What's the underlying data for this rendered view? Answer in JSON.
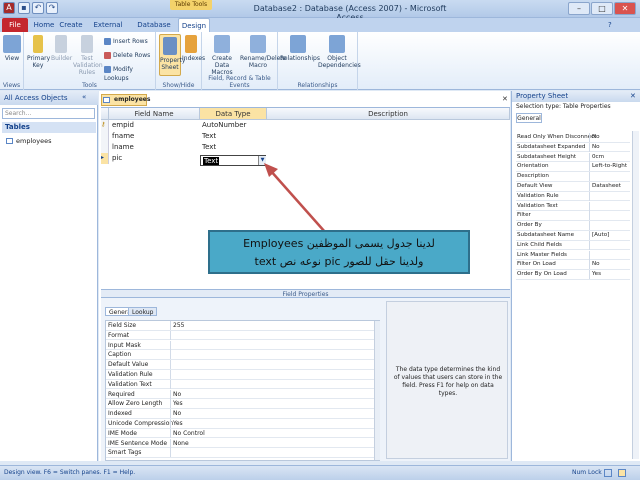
{
  "window": {
    "title": "Database2 : Database (Access 2007) - Microsoft Access",
    "context_tab": "Table Tools"
  },
  "tabs": [
    "File",
    "Home",
    "Create",
    "External Data",
    "Database Tools",
    "Design"
  ],
  "ribbon": {
    "views": {
      "view_label": "View",
      "group": "Views"
    },
    "tools": {
      "primary_key": "Primary Key",
      "builder": "Builder",
      "test_validation": "Test Validation Rules",
      "insert_rows": "Insert Rows",
      "delete_rows": "Delete Rows",
      "modify_lookups": "Modify Lookups",
      "group": "Tools"
    },
    "showhide": {
      "property_sheet": "Property Sheet",
      "indexes": "Indexes",
      "group": "Show/Hide"
    },
    "events": {
      "create_macros": "Create Data Macros",
      "rename_macro": "Rename/Delete Macro",
      "group": "Field, Record & Table Events"
    },
    "relationships": {
      "relationships": "Relationships",
      "dependencies": "Object Dependencies",
      "group": "Relationships"
    }
  },
  "nav": {
    "header": "All Access Objects",
    "search_placeholder": "Search...",
    "section": "Tables",
    "item": "employees"
  },
  "doc_tab": "employees",
  "grid": {
    "headers": [
      "Field Name",
      "Data Type",
      "Description"
    ],
    "rows": [
      {
        "name": "empid",
        "type": "AutoNumber"
      },
      {
        "name": "fname",
        "type": "Text"
      },
      {
        "name": "lname",
        "type": "Text"
      },
      {
        "name": "pic",
        "type": "Text"
      }
    ]
  },
  "field_properties": {
    "label": "Field Properties",
    "tabs": [
      "General",
      "Lookup"
    ],
    "rows": [
      {
        "k": "Field Size",
        "v": "255"
      },
      {
        "k": "Format",
        "v": ""
      },
      {
        "k": "Input Mask",
        "v": ""
      },
      {
        "k": "Caption",
        "v": ""
      },
      {
        "k": "Default Value",
        "v": ""
      },
      {
        "k": "Validation Rule",
        "v": ""
      },
      {
        "k": "Validation Text",
        "v": ""
      },
      {
        "k": "Required",
        "v": "No"
      },
      {
        "k": "Allow Zero Length",
        "v": "Yes"
      },
      {
        "k": "Indexed",
        "v": "No"
      },
      {
        "k": "Unicode Compression",
        "v": "Yes"
      },
      {
        "k": "IME Mode",
        "v": "No Control"
      },
      {
        "k": "IME Sentence Mode",
        "v": "None"
      },
      {
        "k": "Smart Tags",
        "v": ""
      }
    ],
    "help": "The data type determines the kind of values that users can store in the field. Press F1 for help on data types."
  },
  "property_sheet": {
    "title": "Property Sheet",
    "selection_type": "Selection type:  Table Properties",
    "tab": "General",
    "rows": [
      {
        "k": "Read Only When Disconnect",
        "v": "No"
      },
      {
        "k": "Subdatasheet Expanded",
        "v": "No"
      },
      {
        "k": "Subdatasheet Height",
        "v": "0cm"
      },
      {
        "k": "Orientation",
        "v": "Left-to-Right"
      },
      {
        "k": "Description",
        "v": ""
      },
      {
        "k": "Default View",
        "v": "Datasheet"
      },
      {
        "k": "Validation Rule",
        "v": ""
      },
      {
        "k": "Validation Text",
        "v": ""
      },
      {
        "k": "Filter",
        "v": ""
      },
      {
        "k": "Order By",
        "v": ""
      },
      {
        "k": "Subdatasheet Name",
        "v": "[Auto]"
      },
      {
        "k": "Link Child Fields",
        "v": ""
      },
      {
        "k": "Link Master Fields",
        "v": ""
      },
      {
        "k": "Filter On Load",
        "v": "No"
      },
      {
        "k": "Order By On Load",
        "v": "Yes"
      }
    ]
  },
  "callout": {
    "line1": "لدينا جدول يسمى الموظفين  Employees",
    "line2": "ولدينا حقل للصور pic نوعه نص text"
  },
  "status": {
    "left": "Design view.  F6 = Switch panes.  F1 = Help.",
    "right": "Num Lock"
  },
  "colors": {
    "file_tab": "#c4262e",
    "callout_bg": "#4aa9c8",
    "arrow": "#c0504d",
    "context_tab": "#f4d26a"
  }
}
